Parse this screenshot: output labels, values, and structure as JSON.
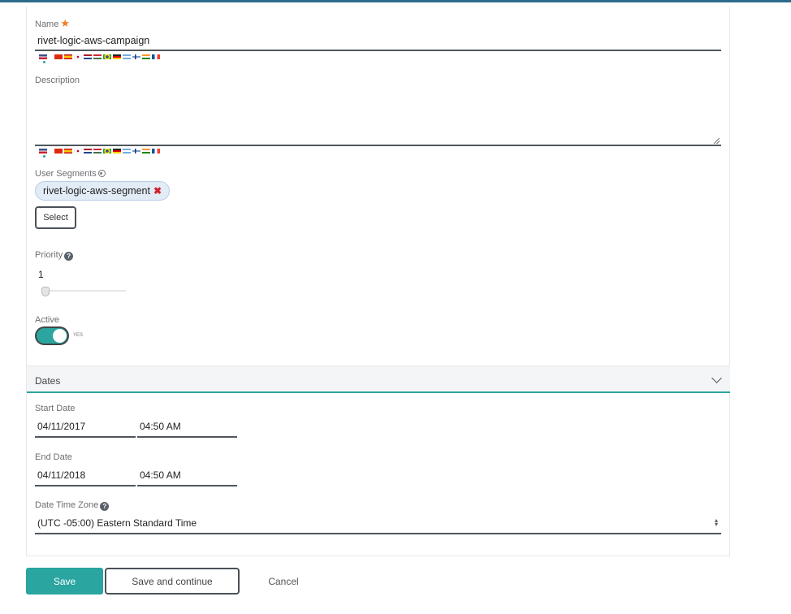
{
  "form": {
    "name_label": "Name",
    "name_value": "rivet-logic-aws-campaign",
    "description_label": "Description",
    "description_value": "",
    "user_segments_label": "User Segments",
    "segment_chip": "rivet-logic-aws-segment",
    "select_button": "Select",
    "priority_label": "Priority",
    "priority_value": "1",
    "priority_slider_level": 0,
    "active_label": "Active",
    "active_state": "YES",
    "help_glyph": "?"
  },
  "dates": {
    "section_title": "Dates",
    "start_date_label": "Start Date",
    "start_date": "04/11/2017",
    "start_time": "04:50 AM",
    "end_date_label": "End Date",
    "end_date": "04/11/2018",
    "end_time": "04:50 AM",
    "timezone_label": "Date Time Zone",
    "timezone_value": "(UTC -05:00) Eastern Standard Time"
  },
  "actions": {
    "save": "Save",
    "save_continue": "Save and continue",
    "cancel": "Cancel"
  },
  "locales": [
    "us",
    "cn",
    "es",
    "jp",
    "nl",
    "hu",
    "br",
    "de",
    "ar",
    "fi",
    "in",
    "fr"
  ],
  "colors": {
    "accent": "#2aa5a0",
    "required_star": "#f47b20",
    "chip_background": "#e2ecf7",
    "remove_icon": "#d0202a"
  }
}
